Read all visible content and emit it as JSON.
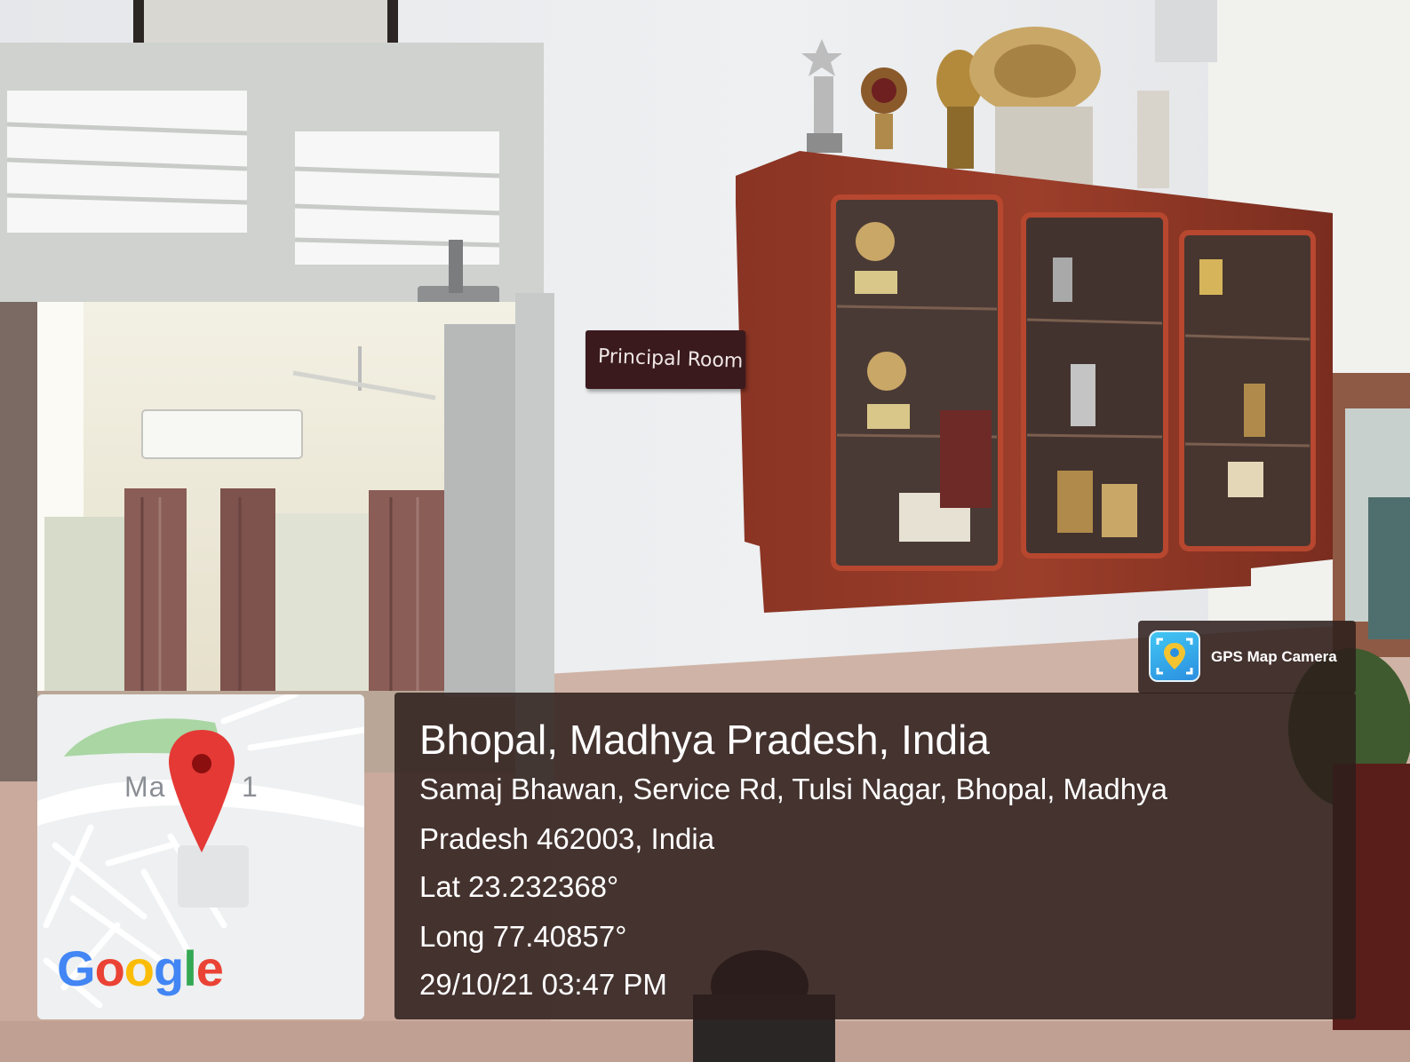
{
  "sign": {
    "text": "Principal Room"
  },
  "map": {
    "road_label": "Ma",
    "road_label_suffix": "1",
    "logo_letters": [
      {
        "char": "G",
        "color": "#4285F4"
      },
      {
        "char": "o",
        "color": "#EA4335"
      },
      {
        "char": "o",
        "color": "#FBBC05"
      },
      {
        "char": "g",
        "color": "#4285F4"
      },
      {
        "char": "l",
        "color": "#34A853"
      },
      {
        "char": "e",
        "color": "#EA4335"
      }
    ],
    "pin_color": "#E53935"
  },
  "location": {
    "title": "Bhopal, Madhya Pradesh, India",
    "address_line1": "Samaj Bhawan, Service Rd, Tulsi Nagar, Bhopal, Madhya",
    "address_line2": "Pradesh 462003, India",
    "latitude": "Lat 23.232368°",
    "longitude": "Long 77.40857°",
    "timestamp": "29/10/21 03:47 PM"
  },
  "brand": {
    "name": "GPS Map Camera",
    "icon": "camera-pin-icon"
  }
}
